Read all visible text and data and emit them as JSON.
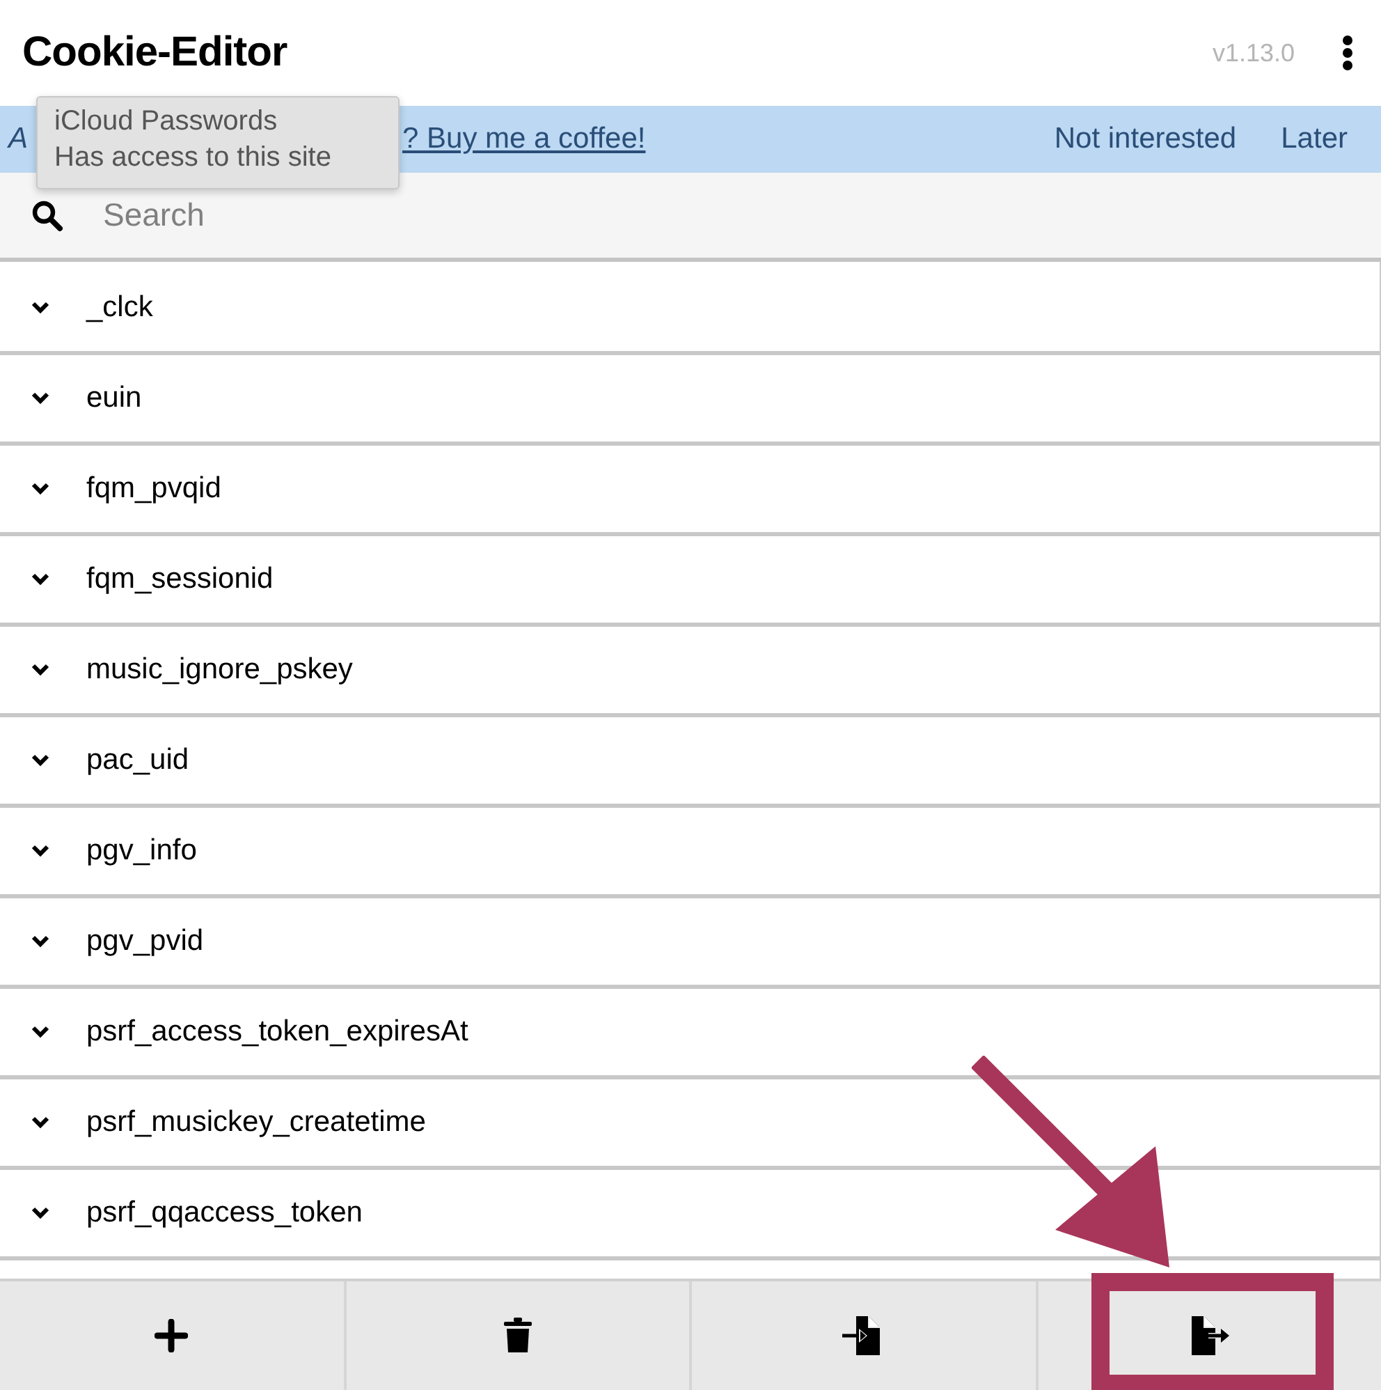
{
  "header": {
    "title": "Cookie-Editor",
    "version": "v1.13.0"
  },
  "banner": {
    "text": "A",
    "link": "? Buy me a coffee!",
    "actions": [
      "Not interested",
      "Later"
    ]
  },
  "tooltip": {
    "lines": [
      "iCloud Passwords",
      "Has access to this site"
    ]
  },
  "search": {
    "placeholder": "Search"
  },
  "cookies": [
    {
      "name": "_clck",
      "expanded": false
    },
    {
      "name": "euin",
      "expanded": false
    },
    {
      "name": "fqm_pvqid",
      "expanded": false
    },
    {
      "name": "fqm_sessionid",
      "expanded": false
    },
    {
      "name": "music_ignore_pskey",
      "expanded": false
    },
    {
      "name": "pac_uid",
      "expanded": false
    },
    {
      "name": "pgv_info",
      "expanded": false
    },
    {
      "name": "pgv_pvid",
      "expanded": false
    },
    {
      "name": "psrf_access_token_expiresAt",
      "expanded": false
    },
    {
      "name": "psrf_musickey_createtime",
      "expanded": false
    },
    {
      "name": "psrf_qqaccess_token",
      "expanded": false
    }
  ],
  "toolbar": [
    {
      "kind": "add",
      "highlighted": false
    },
    {
      "kind": "delete",
      "highlighted": false
    },
    {
      "kind": "import",
      "highlighted": false
    },
    {
      "kind": "export",
      "highlighted": true
    }
  ]
}
